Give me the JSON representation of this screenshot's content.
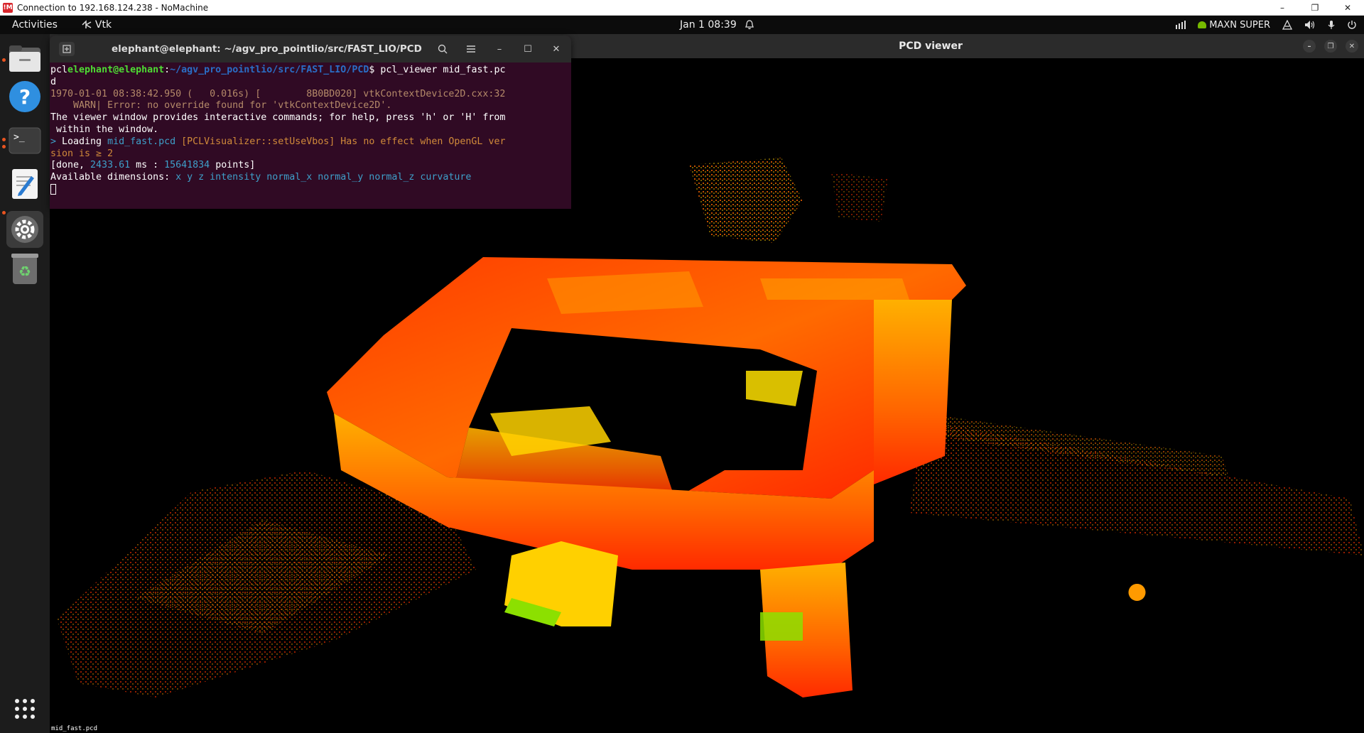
{
  "nomachine": {
    "title": "Connection to 192.168.124.238 - NoMachine",
    "logo_text": "!M",
    "controls": {
      "minimize": "–",
      "restore": "❐",
      "close": "✕"
    }
  },
  "topbar": {
    "activities": "Activities",
    "app_name": "Vtk",
    "clock": "Jan 1  08:39",
    "power_mode": "MAXN SUPER"
  },
  "dock": {
    "items": [
      "Files",
      "Help",
      "Terminal",
      "Text Editor",
      "Settings",
      "Trash",
      "Show Apps"
    ]
  },
  "pcd_viewer": {
    "title": "PCD viewer",
    "cloud_label": "mid_fast.pcd",
    "colors": {
      "hot": "#ff2a00",
      "mid": "#ff7a00",
      "bright": "#ffd200",
      "green": "#8ce000"
    }
  },
  "terminal": {
    "title": "elephant@elephant: ~/agv_pro_pointlio/src/FAST_LIO/PCD",
    "prompt_prefix": "pcl",
    "prompt_user": "elephant@elephant",
    "prompt_colon": ":",
    "prompt_path": "~/agv_pro_pointlio/src/FAST_LIO/PCD",
    "prompt_cmd": "$ pcl_viewer mid_fast.pc",
    "prompt_cmd_wrap": "d",
    "warn_line1": "1970-01-01 08:38:42.950 (   0.016s) [        8B0BD020] vtkContextDevice2D.cxx:32",
    "warn_line2": "    WARN| Error: no override found for 'vtkContextDevice2D'.",
    "info_line1": "The viewer window provides interactive commands; for help, press 'h' or 'H' from",
    "info_line2": " within the window.",
    "load_arrow": "> ",
    "load_text": "Loading ",
    "load_file": "mid_fast.pcd",
    "load_warn": " [PCLVisualizer::setUseVbos] Has no effect when OpenGL ver",
    "load_warn_wrap": "sion is ≥ 2",
    "done_prefix": "[done, ",
    "done_ms": "2433.61",
    "done_mid": " ms : ",
    "done_points": "15641834",
    "done_suffix": " points]",
    "dims_label": "Available dimensions: ",
    "dims_values": "x y z intensity normal_x normal_y normal_z curvature"
  }
}
